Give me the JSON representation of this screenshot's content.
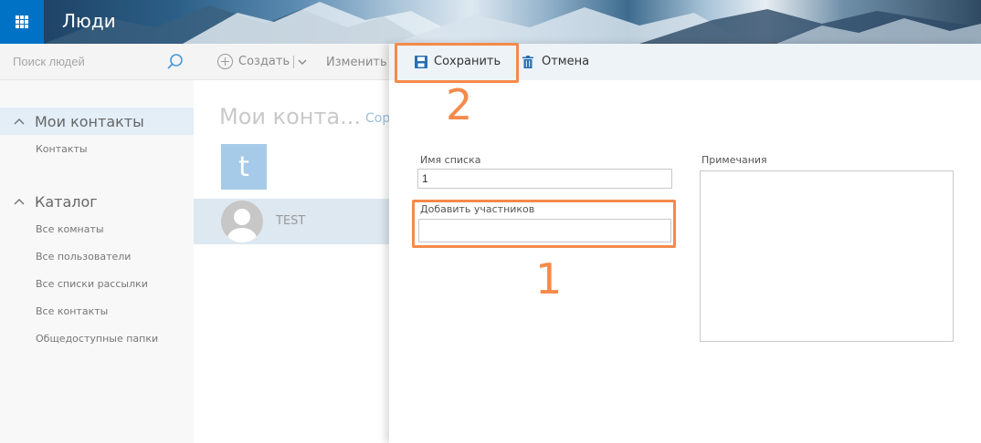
{
  "header": {
    "app_title": "Люди"
  },
  "search": {
    "placeholder": "Поиск людей"
  },
  "sidebar": {
    "sections": [
      {
        "label": "Мои контакты",
        "items": [
          "Контакты"
        ]
      },
      {
        "label": "Каталог",
        "items": [
          "Все комнаты",
          "Все пользователи",
          "Все списки рассылки",
          "Все контакты",
          "Общедоступные папки"
        ]
      }
    ]
  },
  "list_toolbar": {
    "create_label": "Создать",
    "edit_label": "Изменить"
  },
  "list": {
    "title": "Мои конта...",
    "sort_label": "Сорт",
    "tile_letter": "t",
    "contact_name": "TEST"
  },
  "panel": {
    "toolbar": {
      "save_label": "Сохранить",
      "cancel_label": "Отмена"
    },
    "list_name_label": "Имя списка",
    "list_name_value": "1",
    "add_members_label": "Добавить участников",
    "add_members_value": "",
    "notes_label": "Примечания",
    "notes_value": ""
  },
  "annotations": {
    "mark_1": "1",
    "mark_2": "2"
  },
  "colors": {
    "accent": "#0072c6",
    "annotation": "#f58a4b",
    "selection": "#e3eef7"
  }
}
